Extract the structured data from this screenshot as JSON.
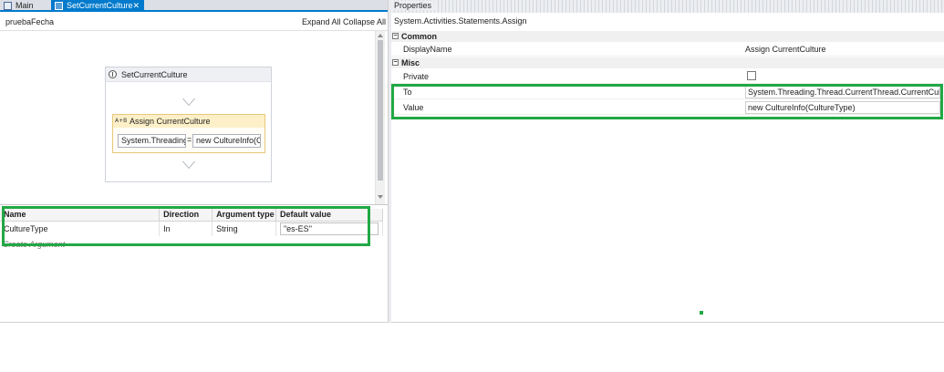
{
  "tabs": [
    {
      "label": "Main",
      "active": false
    },
    {
      "label": "SetCurrentCulture",
      "active": true,
      "close": "✕"
    }
  ],
  "designer": {
    "breadcrumb": "pruebaFecha",
    "expand_all": "Expand All",
    "collapse_all": "Collapse All",
    "sequence_title": "SetCurrentCulture",
    "assign": {
      "icon_text": "A+B",
      "title": "Assign CurrentCulture",
      "to_value": "System.Threading.T",
      "equals": "=",
      "value_value": "new CultureInfo(C"
    }
  },
  "arguments": {
    "headers": [
      "Name",
      "Direction",
      "Argument type",
      "Default value"
    ],
    "rows": [
      {
        "name": "CultureType",
        "direction": "In",
        "type": "String",
        "default": "\"es-ES\""
      }
    ],
    "create_label": "Create Argument"
  },
  "properties": {
    "panel_title": "Properties",
    "type_name": "System.Activities.Statements.Assign",
    "categories": [
      {
        "label": "Common",
        "toggle": "−"
      },
      {
        "label": "Misc",
        "toggle": "−"
      }
    ],
    "display_name": {
      "label": "DisplayName",
      "value": "Assign CurrentCulture"
    },
    "private": {
      "label": "Private",
      "checked": false
    },
    "to": {
      "label": "To",
      "value": "System.Threading.Thread.CurrentThread.CurrentCulture"
    },
    "value": {
      "label": "Value",
      "value": "new CultureInfo(CultureType)"
    }
  },
  "colors": {
    "accent": "#007acc",
    "highlight": "#22a845"
  }
}
